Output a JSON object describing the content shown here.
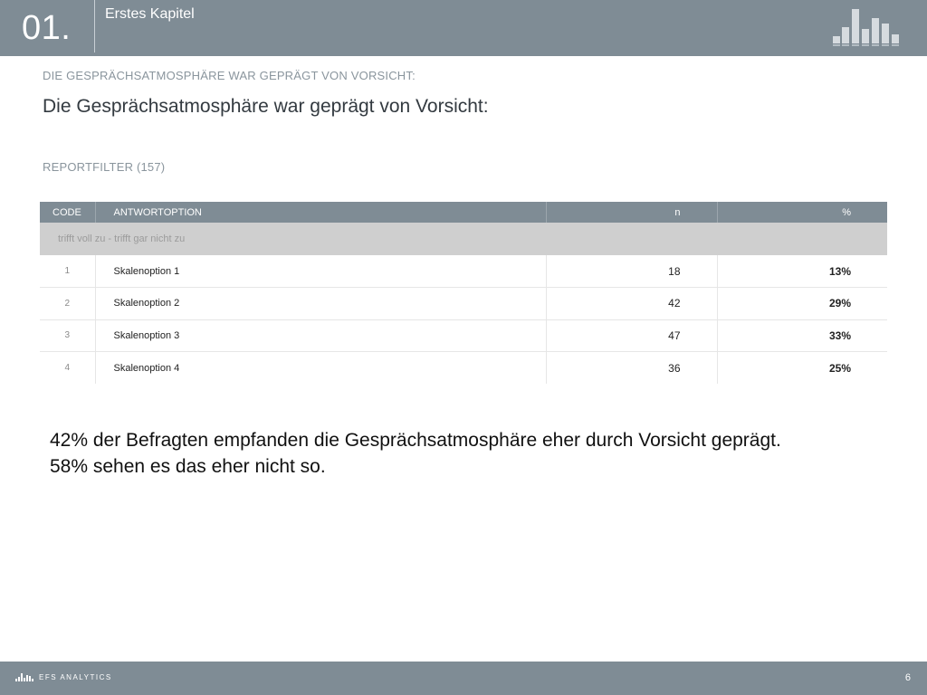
{
  "header": {
    "chapter_number": "01.",
    "chapter_title": "Erstes Kapitel"
  },
  "question": {
    "caps_label": "DIE GESPRÄCHSATMOSPHÄRE WAR GEPRÄGT VON VORSICHT:",
    "title": "Die Gesprächsatmosphäre war geprägt von Vorsicht:"
  },
  "filter": {
    "label": "REPORTFILTER (157)"
  },
  "table": {
    "headers": {
      "code": "CODE",
      "option": "ANTWORTOPTION",
      "n": "n",
      "pct": "%"
    },
    "scale_label": "trifft voll zu - trifft gar nicht zu",
    "rows": [
      {
        "code": "1",
        "option": "Skalenoption 1",
        "n": "18",
        "pct": "13%"
      },
      {
        "code": "2",
        "option": "Skalenoption 2",
        "n": "42",
        "pct": "29%"
      },
      {
        "code": "3",
        "option": "Skalenoption 3",
        "n": "47",
        "pct": "33%"
      },
      {
        "code": "4",
        "option": "Skalenoption 4",
        "n": "36",
        "pct": "25%"
      }
    ]
  },
  "summary": {
    "line1": "42% der Befragten empfanden die Gesprächsatmosphäre eher durch Vorsicht geprägt.",
    "line2": "58% sehen es das eher nicht so."
  },
  "footer": {
    "brand": "EFS ANALYTICS",
    "page_number": "6"
  },
  "colors": {
    "band": "#7f8c95",
    "scale_row": "#cfcfcf"
  }
}
